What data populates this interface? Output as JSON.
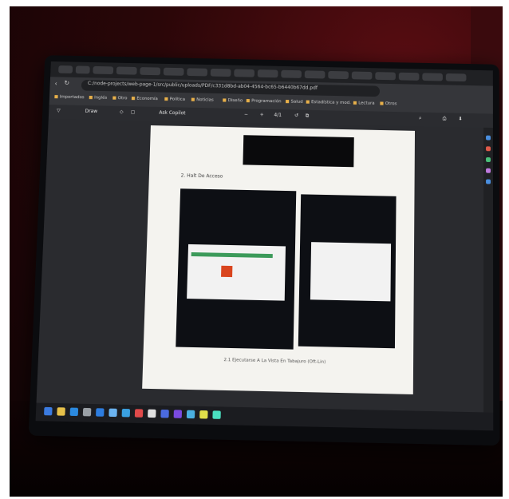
{
  "browser": {
    "url": "C:/node-projects/web-page-1/src/public/uploads/PDF/c331d8bd-ab04-4564-bc65-b6440b67dd.pdf",
    "bookmarks": [
      "Importados",
      "Inglés",
      "Otro",
      "Economía",
      "Política",
      "Noticias",
      "Diseño",
      "Programación",
      "Salud",
      "Estadística y mod.",
      "Lectura",
      "Otros"
    ]
  },
  "pdf_toolbar": {
    "draw_label": "Draw",
    "ask_copilot_label": "Ask Copilot",
    "zoom_value": "",
    "page_indicator": "4/1"
  },
  "pdf_page": {
    "section_heading": "2. Halt De Acceso",
    "caption": "2.1 Ejecutarse A La Vista En Tabajuro (Oft-Lin)"
  },
  "taskbar": {
    "time": "",
    "date": ""
  },
  "colors": {
    "wall": "#3a0a0d",
    "monitor_bezel": "#0b0c0f",
    "accent_green": "#3c9a5a",
    "accent_red": "#d9451e",
    "bookmark_folder": "#e8b04a"
  }
}
